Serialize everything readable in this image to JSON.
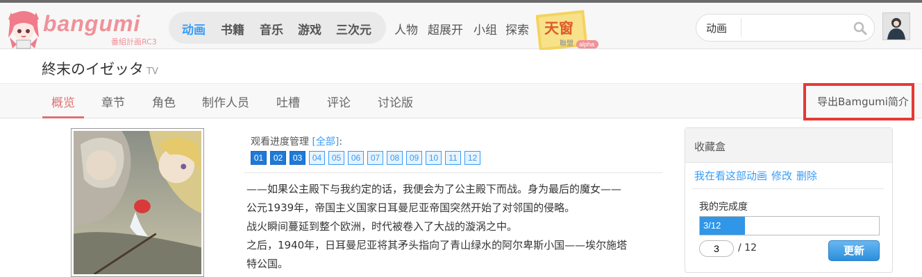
{
  "brand": {
    "name": "bangumi",
    "subtitle": "番組計画RC3"
  },
  "main_nav": [
    "动画",
    "书籍",
    "音乐",
    "游戏",
    "三次元"
  ],
  "main_nav_active": "动画",
  "sub_nav": [
    "人物",
    "超展开",
    "小组",
    "探索"
  ],
  "banner": {
    "text": "天窗",
    "sub": "聯盟",
    "badge": "alpha"
  },
  "search": {
    "category": "动画",
    "value": ""
  },
  "subject": {
    "title": "終末のイゼッタ",
    "type": "TV"
  },
  "tabs": [
    "概览",
    "章节",
    "角色",
    "制作人员",
    "吐槽",
    "评论",
    "讨论版"
  ],
  "tabs_active": "概览",
  "export_label": "导出Bamgumi简介",
  "progress": {
    "label": "观看进度管理",
    "all_link": "[全部]",
    "colon": ":",
    "episodes": [
      "01",
      "02",
      "03",
      "04",
      "05",
      "06",
      "07",
      "08",
      "09",
      "10",
      "11",
      "12"
    ],
    "watched_count": 3
  },
  "summary": [
    "——如果公主殿下与我约定的话，我便会为了公主殿下而战。身为最后的魔女——",
    "公元1939年，帝国主义国家日耳曼尼亚帝国突然开始了对邻国的侵略。",
    "战火瞬间蔓延到整个欧洲，时代被卷入了大战的漩涡之中。",
    "之后，1940年，日耳曼尼亚将其矛头指向了青山绿水的阿尔卑斯小国——埃尔施塔",
    "特公国。"
  ],
  "collection": {
    "title": "收藏盒",
    "status": "我在看这部动画",
    "edit": "修改",
    "delete": "删除",
    "completion_label": "我的完成度",
    "progress_text": "3/12",
    "progress_fraction": 0.25,
    "current": "3",
    "total": "/ 12",
    "update_label": "更新"
  },
  "colors": {
    "accent": "#369cf8",
    "brand": "#f09199",
    "tab_active": "#e07070",
    "highlight": "#e53935"
  }
}
